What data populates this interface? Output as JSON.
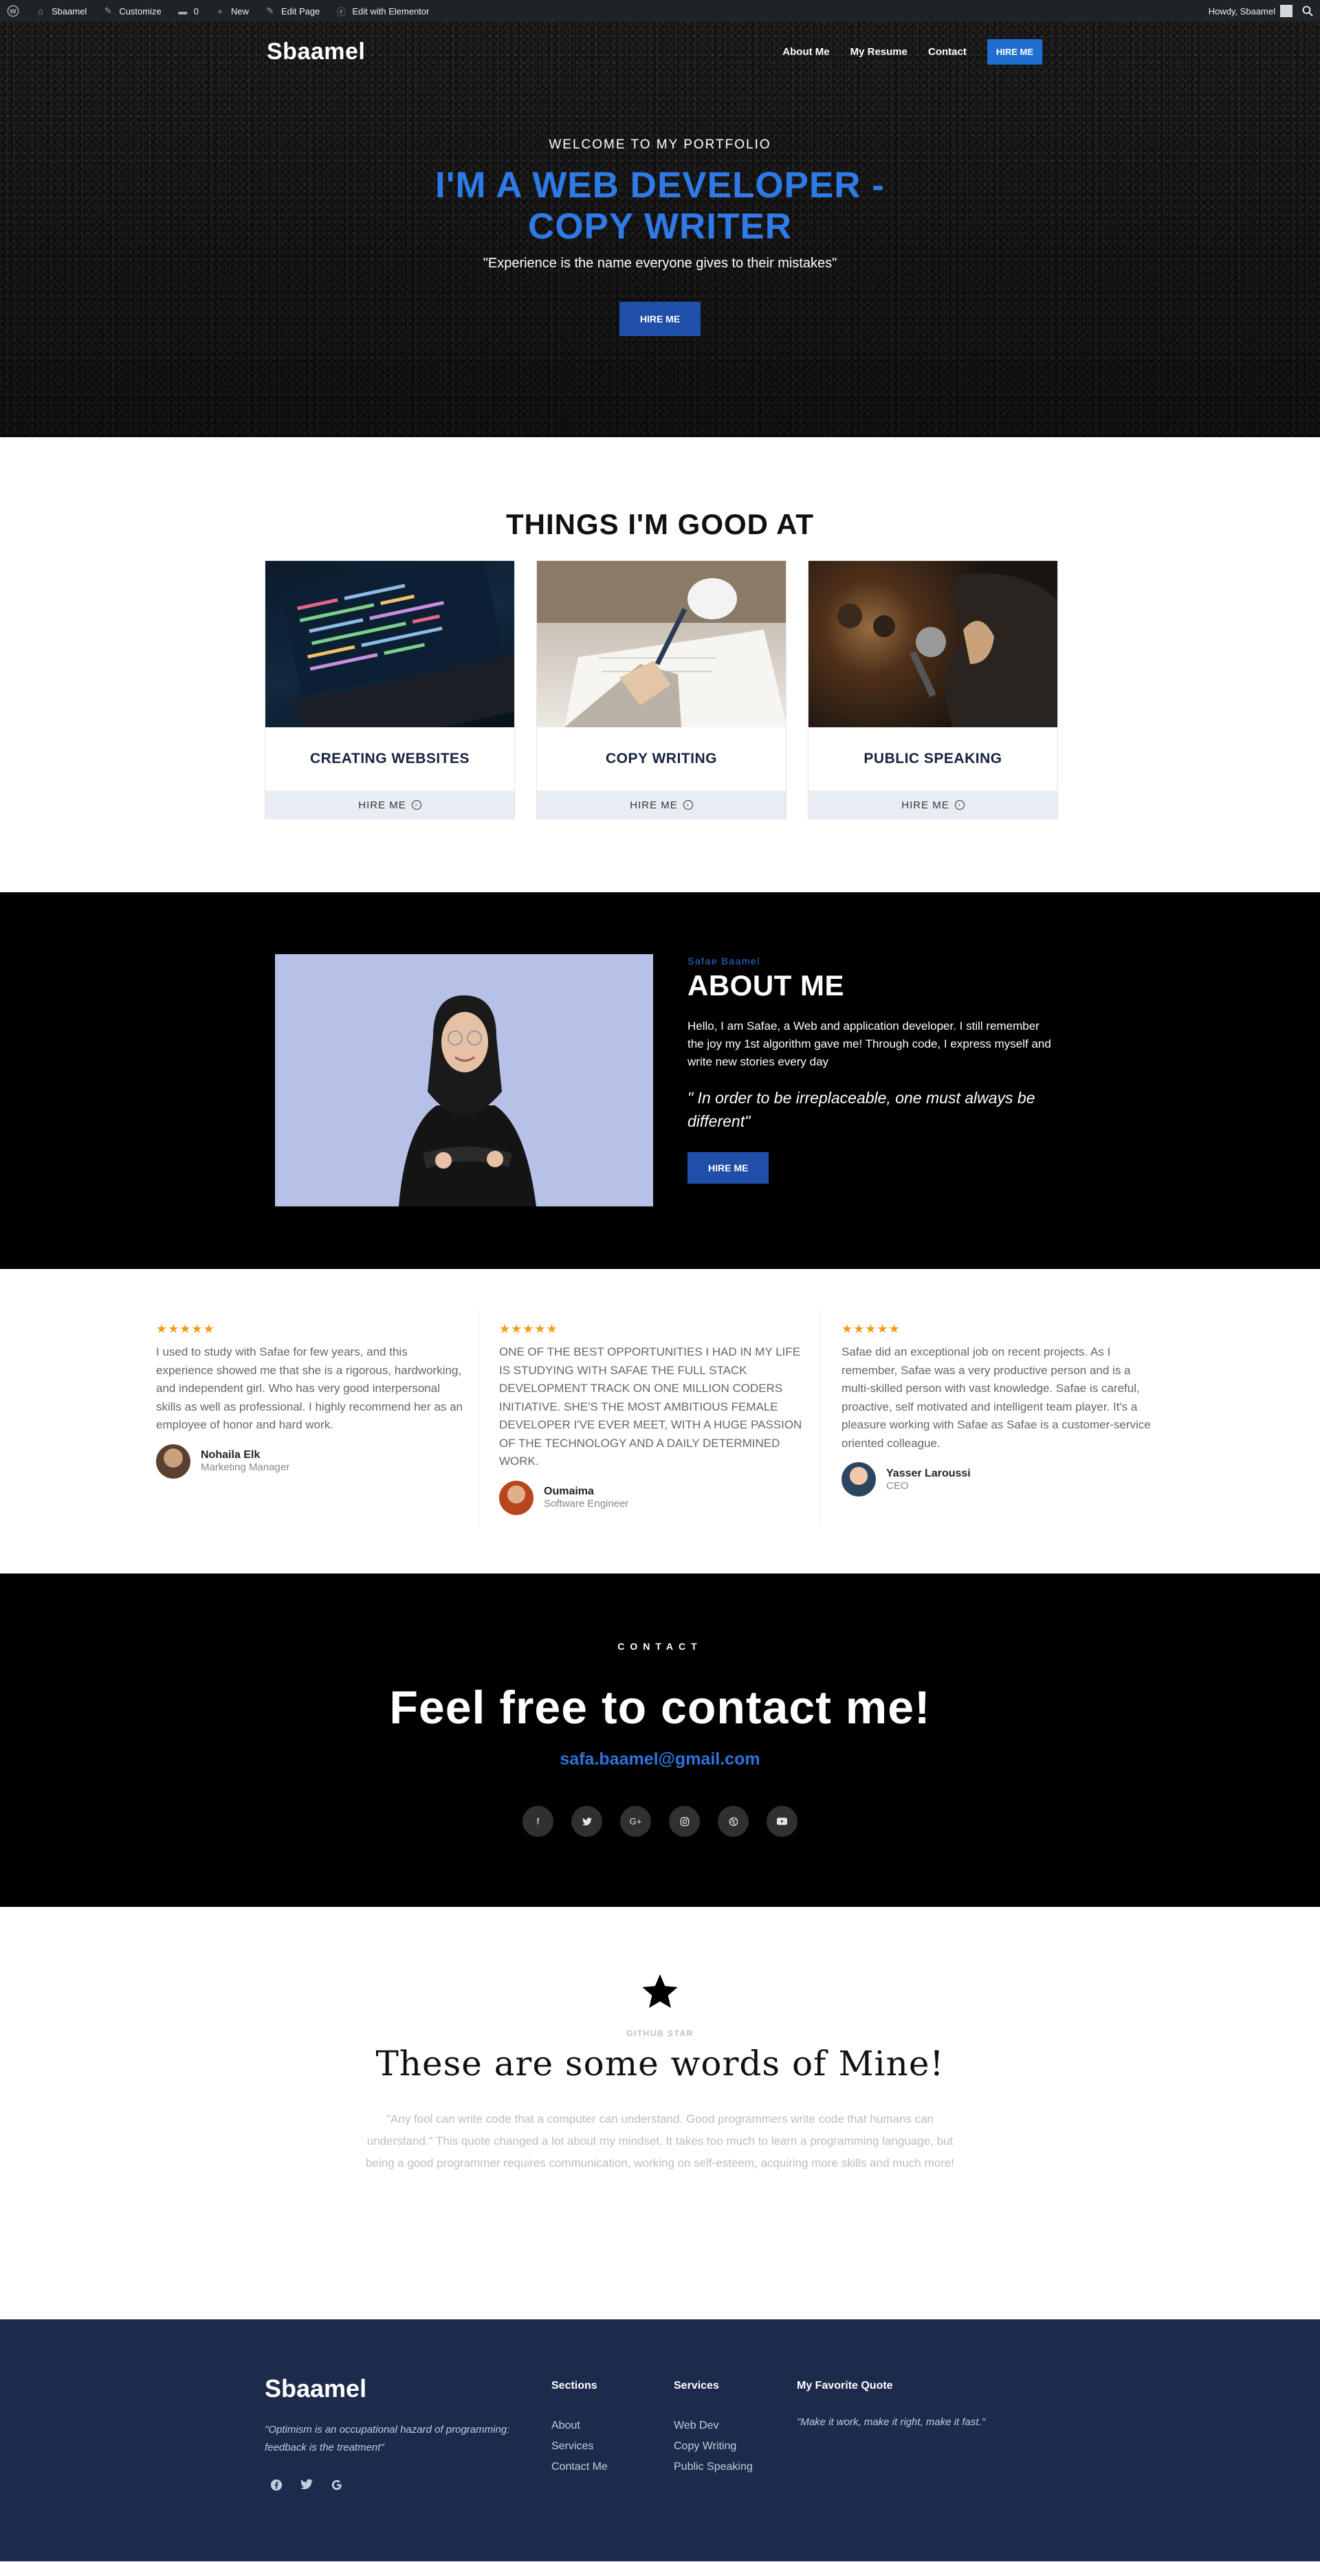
{
  "adminbar": {
    "site": "Sbaamel",
    "customize": "Customize",
    "comments": "0",
    "new": "New",
    "edit_page": "Edit Page",
    "elementor": "Edit with Elementor",
    "howdy": "Howdy, Sbaamel"
  },
  "nav": {
    "logo": "Sbaamel",
    "items": [
      "About Me",
      "My Resume",
      "Contact"
    ],
    "hire": "HIRE ME"
  },
  "hero": {
    "welcome": "WELCOME TO MY PORTFOLIO",
    "title_line1": "I'M A WEB DEVELOPER -",
    "title_line2": "COPY WRITER",
    "quote": "\"Experience is the name everyone gives to their mistakes\"",
    "button": "HIRE ME"
  },
  "skills": {
    "heading": "THINGS I'M GOOD AT",
    "cards": [
      {
        "title": "CREATING WEBSITES",
        "cta": "HIRE ME"
      },
      {
        "title": "COPY WRITING",
        "cta": "HIRE ME"
      },
      {
        "title": "PUBLIC SPEAKING",
        "cta": "HIRE ME"
      }
    ]
  },
  "about": {
    "small": "Safae Baamel",
    "heading": "ABOUT ME",
    "text": "Hello, I am Safae, a Web and application developer. I still remember the joy my 1st algorithm gave me! Through code, I express myself and write new stories every day",
    "quote": "\" In order to be irreplaceable, one must always be different\"",
    "button": "HIRE ME"
  },
  "testimonials": [
    {
      "stars": "★★★★★",
      "text": "I used to study with Safae for few years, and this experience showed me that she is a rigorous, hardworking, and independent girl. Who has very good interpersonal skills as well as professional. I highly recommend her as an employee of honor and hard work.",
      "name": "Nohaila Elk",
      "role": "Marketing Manager"
    },
    {
      "stars": "★★★★★",
      "text": "ONE OF THE BEST OPPORTUNITIES I HAD IN MY LIFE IS STUDYING WITH SAFAE THE FULL STACK DEVELOPMENT TRACK ON ONE MILLION CODERS INITIATIVE. SHE'S THE MOST AMBITIOUS FEMALE DEVELOPER I'VE EVER MEET, WITH A HUGE PASSION OF THE TECHNOLOGY AND A DAILY DETERMINED WORK.",
      "name": "Oumaima",
      "role": "Software Engineer"
    },
    {
      "stars": "★★★★★",
      "text": "Safae did an exceptional job on recent projects. As I remember, Safae was a very productive person and is a multi-skilled person with vast knowledge. Safae is careful, proactive, self motivated and intelligent team player. It's a pleasure working with Safae as Safae is a customer-service oriented colleague.",
      "name": "Yasser Laroussi",
      "role": "CEO"
    }
  ],
  "contact": {
    "label": "CONTACT",
    "heading": "Feel free to contact me!",
    "email": "safa.baamel@gmail.com",
    "socials": [
      "f",
      "t",
      "G+",
      "ig",
      "dr",
      "yt"
    ]
  },
  "words": {
    "sub": "GITHUB STAR",
    "heading": "These are some words of Mine!",
    "text": "\"Any fool can write code that a computer can understand. Good programmers write code that humans can understand.\" This quote changed a lot about my mindset. It takes too much to learn a programming language, but being a good programmer requires communication, working on self-esteem, acquiring more skills and much more!"
  },
  "footer": {
    "logo": "Sbaamel",
    "quote": "\"Optimism is an occupational hazard of programming: feedback is the treatment\"",
    "sections_title": "Sections",
    "sections": [
      "About",
      "Services",
      "Contact Me"
    ],
    "services_title": "Services",
    "services": [
      "Web Dev",
      "Copy Writing",
      "Public Speaking"
    ],
    "fav_title": "My Favorite Quote",
    "fav_quote": "\"Make it work, make it right, make it fast.\""
  },
  "colors": {
    "accent": "#2e7ae6",
    "button": "#1f4fa8",
    "star": "#f39c12",
    "footer_bg": "#1c2b4b"
  }
}
